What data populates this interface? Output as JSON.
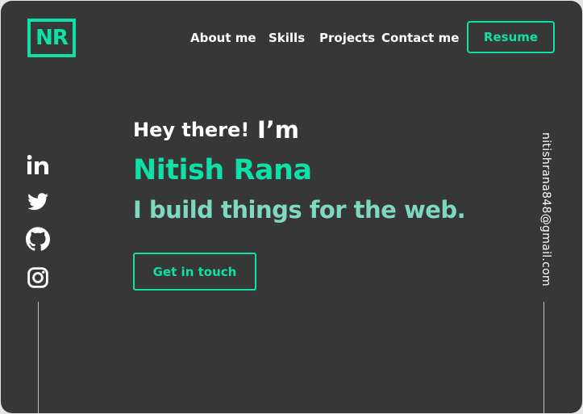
{
  "brand": {
    "logo_text": "NR",
    "accent_color": "#0fe0a8"
  },
  "nav": {
    "items": [
      {
        "label": "About me"
      },
      {
        "label": "Skills"
      },
      {
        "label": "Projects"
      },
      {
        "label": "Contact me"
      }
    ],
    "resume_label": "Resume"
  },
  "social": [
    {
      "icon": "linkedin-icon"
    },
    {
      "icon": "twitter-icon"
    },
    {
      "icon": "github-icon"
    },
    {
      "icon": "instagram-icon"
    }
  ],
  "hero": {
    "greeting": "Hey there!",
    "greeting_suffix": "I’m",
    "name": "Nitish Rana",
    "tagline": "I build things for the web.",
    "cta_label": "Get in touch"
  },
  "contact": {
    "email": "nitishrana848@gmail.com"
  },
  "colors": {
    "background": "#373737",
    "accent": "#0fe0a8",
    "tagline": "#7ed9c0",
    "text": "#ffffff"
  }
}
